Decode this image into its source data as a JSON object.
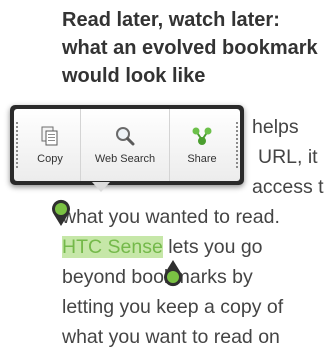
{
  "article": {
    "headline_lines": [
      "Read later, watch later:",
      "what an evolved bookmark",
      "would look like"
    ],
    "body_lines": [
      "helps",
      "URL, it",
      "access t",
      "what you wanted to read.",
      "lets you go",
      "beyond bookmarks by",
      "letting you keep a copy of",
      "what you want to read on"
    ],
    "selected_text": "HTC Sense"
  },
  "popup": {
    "items": [
      {
        "label": "Copy",
        "icon": "copy-icon"
      },
      {
        "label": "Web Search",
        "icon": "search-icon"
      },
      {
        "label": "Share",
        "icon": "share-icon"
      }
    ]
  },
  "colors": {
    "selection_bg": "#c6e7a8",
    "selection_text": "#74b94a",
    "handle": "#7ac143",
    "share_green": "#4a9e2e"
  }
}
